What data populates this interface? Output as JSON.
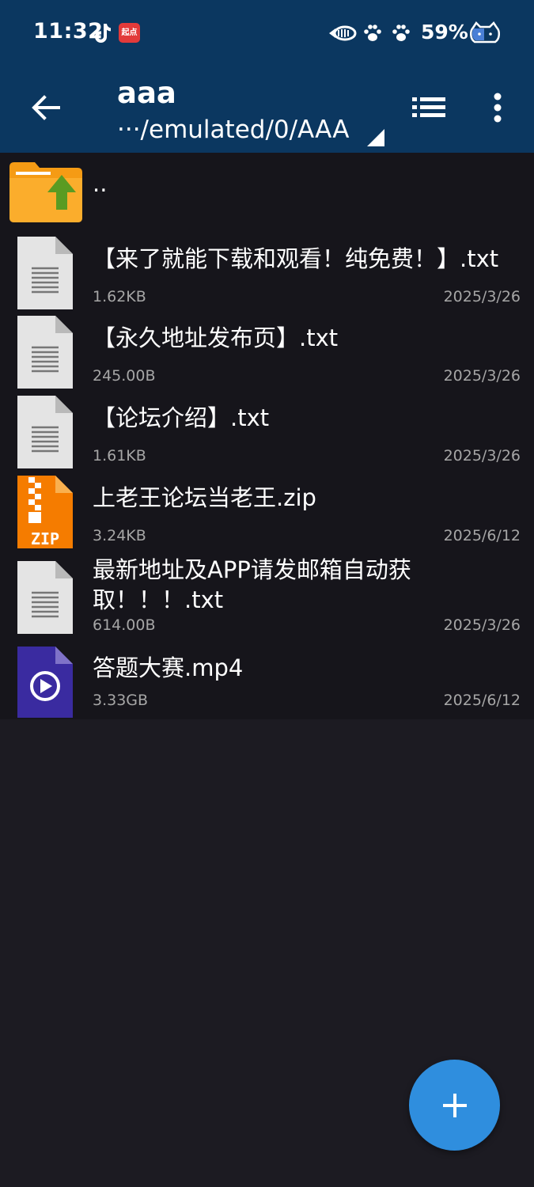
{
  "status_bar": {
    "time": "11:32",
    "app_badge": "起点",
    "battery": "59%",
    "icons": [
      "tiktok-icon",
      "qidian-app-icon",
      "fish-icon",
      "paw-icon",
      "paw-icon",
      "cat-battery-icon"
    ]
  },
  "toolbar": {
    "title": "aaa",
    "path": "···/emulated/0/AAA",
    "icons": [
      "back-arrow-icon",
      "list-view-icon",
      "more-vert-icon"
    ]
  },
  "parent_entry": {
    "label": ".."
  },
  "files": [
    {
      "name": "【来了就能下载和观看！纯免费！】.txt",
      "size": "1.62KB",
      "date": "2025/3/26",
      "icon": "text-file-icon"
    },
    {
      "name": "【永久地址发布页】.txt",
      "size": "245.00B",
      "date": "2025/3/26",
      "icon": "text-file-icon"
    },
    {
      "name": "【论坛介绍】.txt",
      "size": "1.61KB",
      "date": "2025/3/26",
      "icon": "text-file-icon"
    },
    {
      "name": "上老王论坛当老王.zip",
      "size": "3.24KB",
      "date": "2025/6/12",
      "icon": "zip-file-icon",
      "icon_label": "ZIP"
    },
    {
      "name": "最新地址及APP请发邮箱自动获取！！！.txt",
      "name_line1": "最新地址及APP请发邮箱自动获",
      "name_line2": "取！！！.txt",
      "size": "614.00B",
      "date": "2025/3/26",
      "icon": "text-file-icon"
    },
    {
      "name": "答题大赛.mp4",
      "size": "3.33GB",
      "date": "2025/6/12",
      "icon": "video-file-icon"
    }
  ],
  "fab": {
    "icon": "plus-icon"
  },
  "colors": {
    "header": "#0b3760",
    "background": "#1c1b22",
    "list_background": "#16151b",
    "fab": "#2f8ede",
    "folder": "#f7a21b",
    "zip": "#f57c00",
    "video": "#3a2ba0",
    "secondary_text": "#a6a6a6"
  }
}
